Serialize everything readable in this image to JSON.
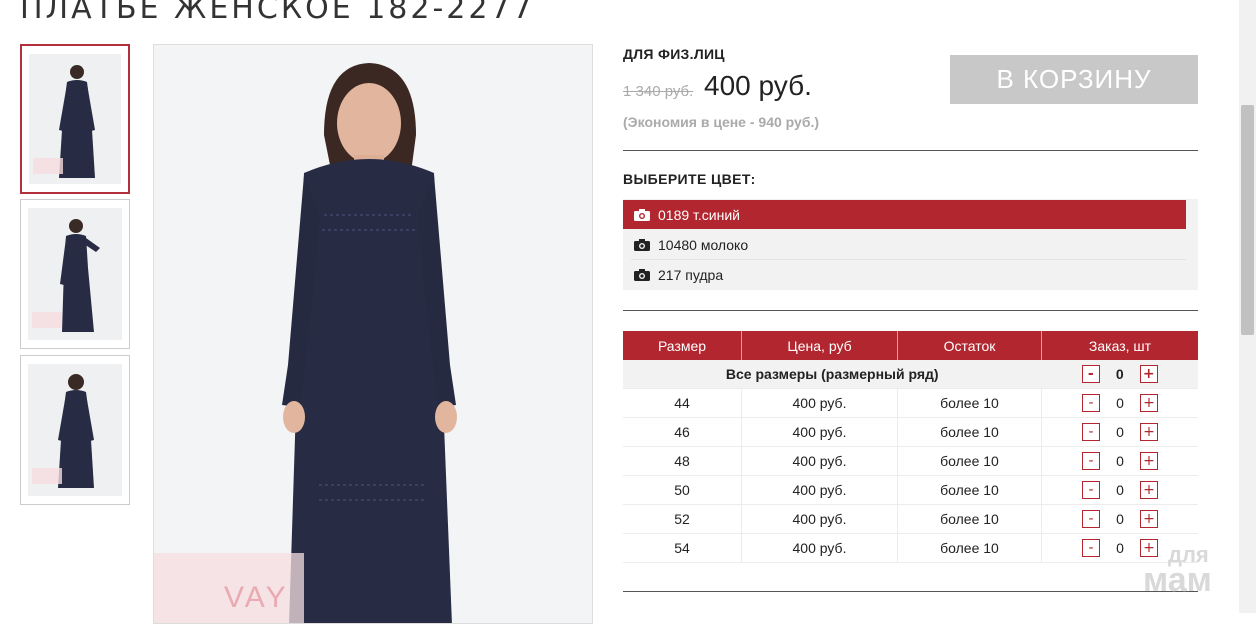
{
  "product": {
    "title": "ПЛАТЬЕ ЖЕНСКОЕ 182-2277"
  },
  "pricing": {
    "customer_type": "ДЛЯ ФИЗ.ЛИЦ",
    "old_price": "1 340 руб.",
    "price": "400 руб.",
    "saving": "(Экономия в цене - 940 руб.)",
    "cart_button": "В КОРЗИНУ"
  },
  "color_select": {
    "heading": "ВЫБЕРИТЕ ЦВЕТ:",
    "options": [
      "0189 т.синий",
      "10480 молоко",
      "217 пудра"
    ],
    "selected_index": 0,
    "option_icon": "camera-icon"
  },
  "sizes_table": {
    "headers": [
      "Размер",
      "Цена, руб",
      "Остаток",
      "Заказ, шт"
    ],
    "all_sizes_label": "Все размеры (размерный ряд)",
    "all_sizes_qty": "0",
    "rows": [
      {
        "size": "44",
        "price": "400 руб.",
        "stock": "более 10",
        "qty": "0"
      },
      {
        "size": "46",
        "price": "400 руб.",
        "stock": "более 10",
        "qty": "0"
      },
      {
        "size": "48",
        "price": "400 руб.",
        "stock": "более 10",
        "qty": "0"
      },
      {
        "size": "50",
        "price": "400 руб.",
        "stock": "более 10",
        "qty": "0"
      },
      {
        "size": "52",
        "price": "400 руб.",
        "stock": "более 10",
        "qty": "0"
      },
      {
        "size": "54",
        "price": "400 руб.",
        "stock": "более 10",
        "qty": "0"
      }
    ],
    "minus": "-",
    "plus": "+"
  },
  "gallery": {
    "watermark": "VAY"
  },
  "watermark": {
    "line1": "для",
    "line2": "мам"
  },
  "colors": {
    "accent": "#b2272f",
    "dress": "#272c44",
    "button_disabled": "#c8c8c8"
  }
}
